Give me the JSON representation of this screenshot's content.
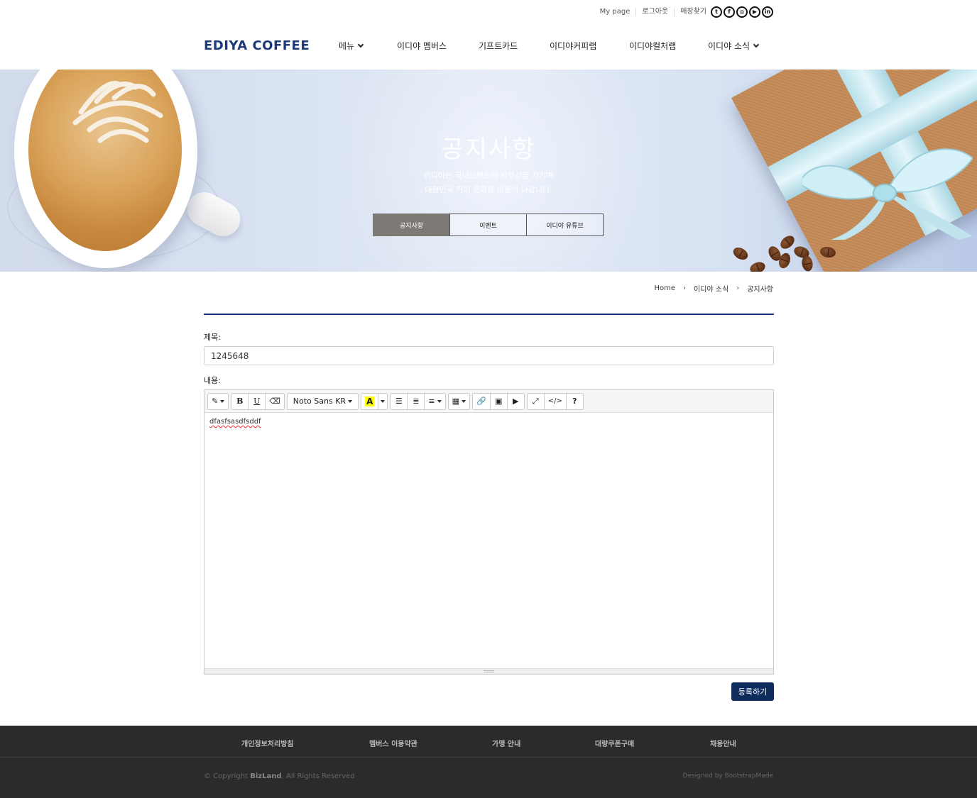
{
  "topbar": {
    "mypage": "My page",
    "logout": "로그아웃",
    "store": "매장찾기",
    "social": [
      "twitter-icon",
      "facebook-icon",
      "instagram-icon",
      "youtube-icon",
      "linkedin-icon"
    ]
  },
  "header": {
    "logo": "EDIYA COFFEE",
    "nav": [
      "메뉴",
      "이디야 멤버스",
      "기프트카드",
      "이디야커피랩",
      "이디야컬처랩",
      "이디야 소식"
    ]
  },
  "hero": {
    "title": "공지사항",
    "sub1": "이디야는 국내브랜드의 자부심을 지키며",
    "sub2": "대한민국 커피 문화를 이끌어 나갑니다.",
    "tabs": [
      "공지사항",
      "이벤트",
      "이디야 유튜브"
    ]
  },
  "breadcrumb": [
    "Home",
    "이디야 소식",
    "공지사항"
  ],
  "form": {
    "title_label": "제목:",
    "title_value": "1245648",
    "content_label": "내용:",
    "content_value": "dfasfsasdfsddf",
    "font_name": "Noto Sans KR",
    "submit": "등록하기"
  },
  "footer": {
    "links": [
      "개인정보처리방침",
      "멤버스 이용약관",
      "가맹 안내",
      "대량쿠폰구매",
      "채용안내"
    ],
    "copyright_prefix": "© Copyright ",
    "copyright_brand": "BizLand",
    "copyright_suffix": ". All Rights Reserved",
    "designed": "Designed by BootstrapMade"
  },
  "colors": {
    "brand": "#1c3a7a",
    "submit": "#0f2d5c",
    "active_tab": "#7d7a76",
    "footer": "#2b2b2b"
  }
}
